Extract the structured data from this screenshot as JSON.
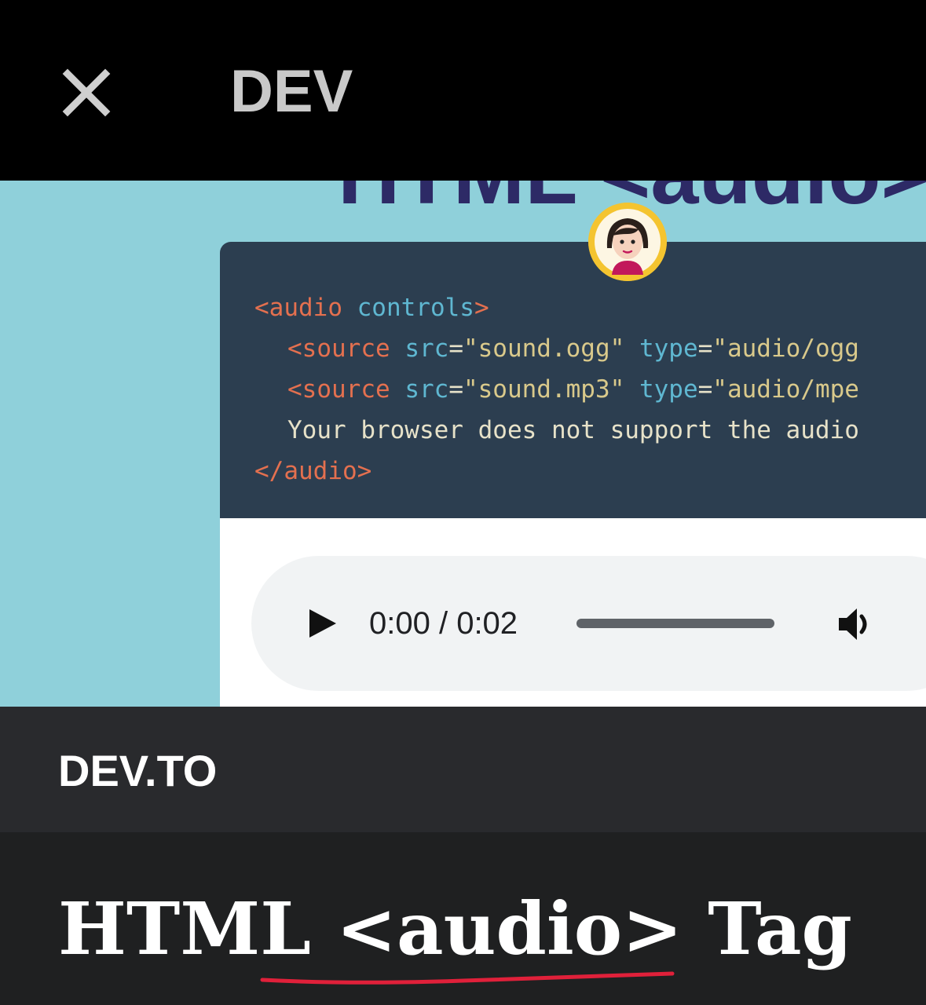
{
  "topbar": {
    "close_icon": "close-icon",
    "title": "DEV"
  },
  "hero": {
    "title_peek": "HTML <audio>",
    "code": {
      "line1": {
        "tag_open": "<audio",
        "attr": " controls",
        "tag_close": ">"
      },
      "line2": {
        "tag": "<source",
        "attr1": " src",
        "eq1": "=",
        "val1": "\"sound.ogg\"",
        "attr2": " type",
        "eq2": "=",
        "val2": "\"audio/ogg"
      },
      "line3": {
        "tag": "<source",
        "attr1": " src",
        "eq1": "=",
        "val1": "\"sound.mp3\"",
        "attr2": " type",
        "eq2": "=",
        "val2": "\"audio/mpe"
      },
      "line4": "Your browser does not support the audio",
      "line5": "</audio>"
    },
    "player": {
      "play_icon": "play-icon",
      "time": "0:00 / 0:02",
      "volume_icon": "volume-icon"
    },
    "avatar_icon": "avatar-icon"
  },
  "source": {
    "label": "DEV.TO"
  },
  "headline": {
    "text": "HTML <audio> Tag"
  },
  "colors": {
    "hero_bg": "#8fd0da",
    "code_bg": "#2c3e50",
    "tag": "#e4704f",
    "attr": "#5fb7d1",
    "string": "#d9c98b",
    "underline": "#e0203a"
  }
}
